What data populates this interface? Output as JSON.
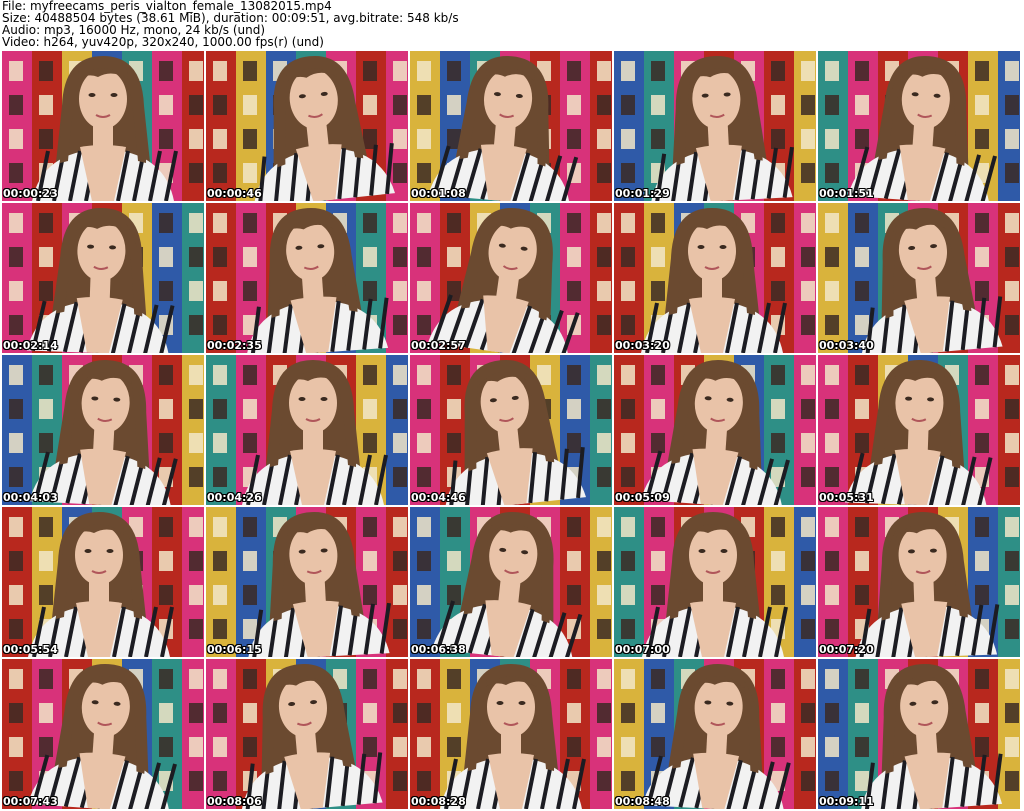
{
  "header": {
    "file_line": "File: myfreecams_peris_vialton_female_13082015.mp4",
    "size_line": "Size: 40488504 bytes (38.61 MiB), duration: 00:09:51, avg.bitrate: 548 kb/s",
    "audio_line": "Audio: mp3, 16000 Hz, mono, 24 kb/s (und)",
    "video_line": "Video: h264, yuv420p, 320x240, 1000.00 fps(r) (und)"
  },
  "thumbnails": [
    {
      "timestamp": "00:00:23"
    },
    {
      "timestamp": "00:00:46"
    },
    {
      "timestamp": "00:01:08"
    },
    {
      "timestamp": "00:01:29"
    },
    {
      "timestamp": "00:01:51"
    },
    {
      "timestamp": "00:02:14"
    },
    {
      "timestamp": "00:02:35"
    },
    {
      "timestamp": "00:02:57"
    },
    {
      "timestamp": "00:03:20"
    },
    {
      "timestamp": "00:03:40"
    },
    {
      "timestamp": "00:04:03"
    },
    {
      "timestamp": "00:04:26"
    },
    {
      "timestamp": "00:04:46"
    },
    {
      "timestamp": "00:05:09"
    },
    {
      "timestamp": "00:05:31"
    },
    {
      "timestamp": "00:05:54"
    },
    {
      "timestamp": "00:06:15"
    },
    {
      "timestamp": "00:06:38"
    },
    {
      "timestamp": "00:07:00"
    },
    {
      "timestamp": "00:07:20"
    },
    {
      "timestamp": "00:07:43"
    },
    {
      "timestamp": "00:08:06"
    },
    {
      "timestamp": "00:08:28"
    },
    {
      "timestamp": "00:08:48"
    },
    {
      "timestamp": "00:09:11"
    }
  ],
  "colors": {
    "background": "#ffffff",
    "header_text": "#000000",
    "timestamp_text": "#ffffff",
    "timestamp_outline": "#000000",
    "hair": "#6b4a30",
    "skin": "#e9c3a8",
    "wall_pink": "#d8327a",
    "wall_red": "#b8281e",
    "wall_yellow": "#d9b33c",
    "wall_blue": "#2f5aa8",
    "wall_teal": "#2e8f86",
    "stripe_dark": "#1c1c22",
    "stripe_light": "#f2f2f2"
  }
}
